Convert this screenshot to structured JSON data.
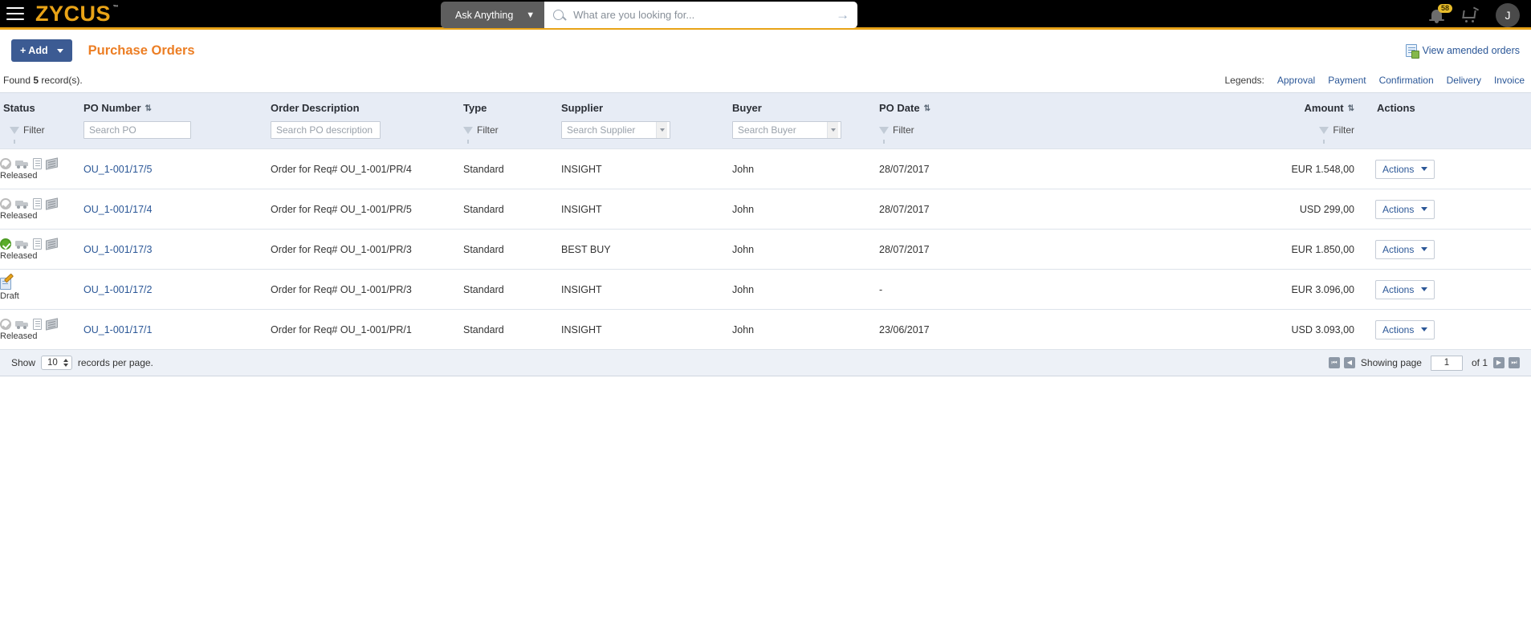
{
  "header": {
    "brand": "ZYCUS",
    "trademark": "™",
    "menu_icon": "hamburger-icon",
    "ask_anything_label": "Ask Anything",
    "ask_anything_caret": "▼",
    "search_placeholder": "What are you looking for...",
    "search_value": "",
    "search_submit_glyph": "→",
    "notification_count": "58",
    "avatar_initial": "J"
  },
  "toolbar": {
    "add_label": "+ Add",
    "page_title": "Purchase Orders",
    "view_amended_label": "View amended orders"
  },
  "meta": {
    "found_prefix": "Found",
    "found_count": "5",
    "found_suffix": "record(s).",
    "legends_label": "Legends:",
    "legends": [
      "Approval",
      "Payment",
      "Confirmation",
      "Delivery",
      "Invoice"
    ]
  },
  "table": {
    "columns": [
      {
        "label": "Status",
        "sortable": false
      },
      {
        "label": "PO Number",
        "sortable": true
      },
      {
        "label": "Order Description",
        "sortable": false
      },
      {
        "label": "Type",
        "sortable": false
      },
      {
        "label": "Supplier",
        "sortable": false
      },
      {
        "label": "Buyer",
        "sortable": false
      },
      {
        "label": "PO Date",
        "sortable": true
      },
      {
        "label": "Amount",
        "sortable": true
      },
      {
        "label": "Actions",
        "sortable": false
      }
    ],
    "sort_glyph": "⇅",
    "filters": {
      "status_filter_label": "Filter",
      "po_number_placeholder": "Search PO",
      "order_description_placeholder": "Search PO description",
      "type_filter_label": "Filter",
      "supplier_placeholder": "Search Supplier",
      "buyer_placeholder": "Search Buyer",
      "po_date_filter_label": "Filter",
      "amount_filter_label": "Filter"
    },
    "rows": [
      {
        "status_label": "Released",
        "status_kind": "released",
        "approval_done": false,
        "po_number": "OU_1-001/17/5",
        "order_description": "Order for Req# OU_1-001/PR/4",
        "type": "Standard",
        "supplier": "INSIGHT",
        "buyer": "John",
        "po_date": "28/07/2017",
        "amount": "EUR 1.548,00",
        "actions_label": "Actions"
      },
      {
        "status_label": "Released",
        "status_kind": "released",
        "approval_done": false,
        "po_number": "OU_1-001/17/4",
        "order_description": "Order for Req# OU_1-001/PR/5",
        "type": "Standard",
        "supplier": "INSIGHT",
        "buyer": "John",
        "po_date": "28/07/2017",
        "amount": "USD 299,00",
        "actions_label": "Actions"
      },
      {
        "status_label": "Released",
        "status_kind": "released",
        "approval_done": true,
        "po_number": "OU_1-001/17/3",
        "order_description": "Order for Req# OU_1-001/PR/3",
        "type": "Standard",
        "supplier": "BEST BUY",
        "buyer": "John",
        "po_date": "28/07/2017",
        "amount": "EUR 1.850,00",
        "actions_label": "Actions"
      },
      {
        "status_label": "Draft",
        "status_kind": "draft",
        "approval_done": false,
        "po_number": "OU_1-001/17/2",
        "order_description": "Order for Req# OU_1-001/PR/3",
        "type": "Standard",
        "supplier": "INSIGHT",
        "buyer": "John",
        "po_date": "-",
        "amount": "EUR 3.096,00",
        "actions_label": "Actions"
      },
      {
        "status_label": "Released",
        "status_kind": "released",
        "approval_done": false,
        "po_number": "OU_1-001/17/1",
        "order_description": "Order for Req# OU_1-001/PR/1",
        "type": "Standard",
        "supplier": "INSIGHT",
        "buyer": "John",
        "po_date": "23/06/2017",
        "amount": "USD 3.093,00",
        "actions_label": "Actions"
      }
    ]
  },
  "footer": {
    "show_label": "Show",
    "page_size": "10",
    "records_per_page_label": "records per page.",
    "first_glyph": "⏮",
    "prev_glyph": "◀",
    "showing_page_label": "Showing page",
    "current_page": "1",
    "of_label": "of 1",
    "next_glyph": "▶",
    "last_glyph": "⏭"
  },
  "colors": {
    "brand_orange": "#e8a317",
    "title_orange": "#ec7e24",
    "link_blue": "#2b5797",
    "add_button_blue": "#3c5b93",
    "header_bg": "#e7ecf5",
    "approved_green": "#5aad2a",
    "badge_yellow": "#e8bc2a"
  }
}
